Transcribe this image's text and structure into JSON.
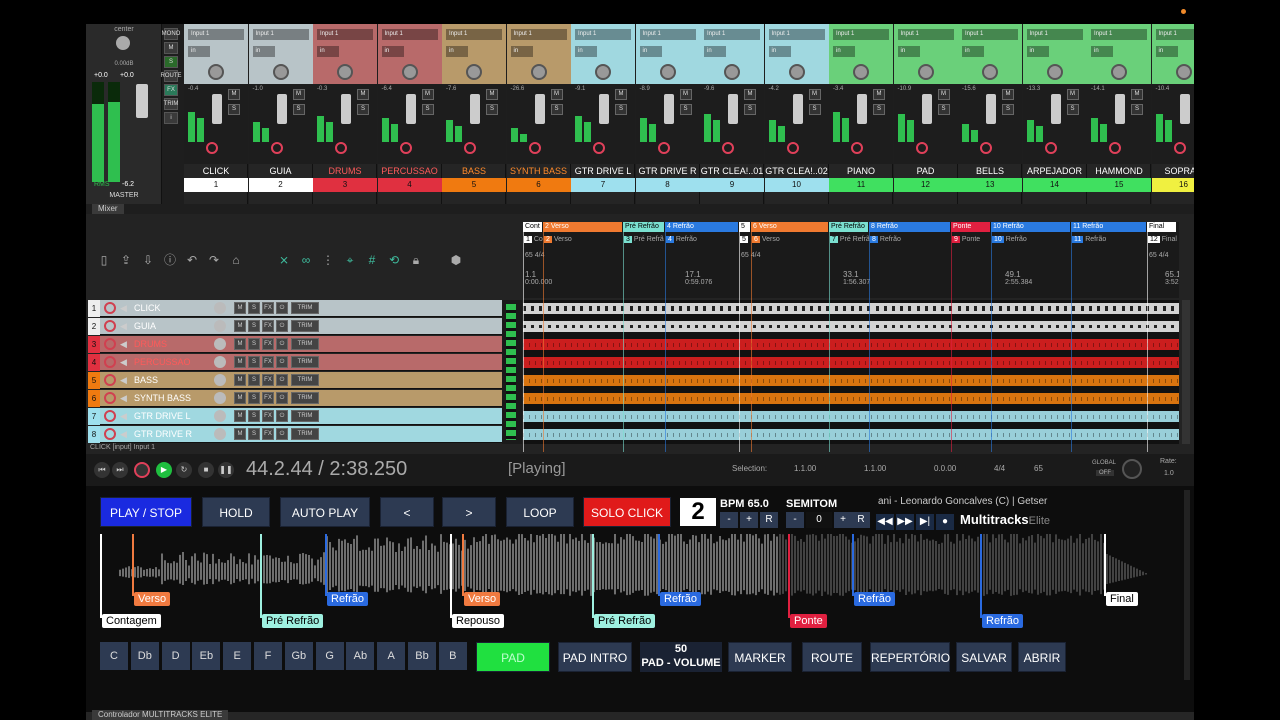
{
  "master": {
    "pan": "center",
    "vol": "0.00dB",
    "peak_l": "+0.0",
    "peak_r": "+0.0",
    "rms_label": "RMS",
    "rms_val": "-6.2",
    "name": "MASTER",
    "side": [
      "MONO",
      "M",
      "S",
      "ROUTE",
      "FX",
      "TRIM"
    ]
  },
  "channels": [
    {
      "input": "Input 1",
      "db": "-0.4",
      "name": "CLICK",
      "num": "1",
      "top": "#b8c4c8",
      "mid": "#c8d0d4",
      "namecolor": "#fff",
      "numbg": "#fff"
    },
    {
      "input": "Input 1",
      "db": "-1.0",
      "name": "GUIA",
      "num": "2",
      "top": "#b8c4c8",
      "mid": "#c8d0d4",
      "namecolor": "#fff",
      "numbg": "#fff"
    },
    {
      "input": "Input 1",
      "db": "-0.3",
      "name": "DRUMS",
      "num": "3",
      "top": "#b86a6a",
      "mid": "#c06060",
      "namecolor": "#ff5a5a",
      "numbg": "#e03040"
    },
    {
      "input": "Input 1",
      "db": "-6.4",
      "name": "PERCUSSAO",
      "num": "4",
      "top": "#b86a6a",
      "mid": "#c06060",
      "namecolor": "#ff5a5a",
      "numbg": "#e03040"
    },
    {
      "input": "Input 1",
      "db": "-7.6",
      "name": "BASS",
      "num": "5",
      "top": "#b89a6a",
      "mid": "#c09060",
      "namecolor": "#ff8a2a",
      "numbg": "#f07a10"
    },
    {
      "input": "Input 1",
      "db": "-26.6",
      "name": "SYNTH BASS",
      "num": "6",
      "top": "#b89a6a",
      "mid": "#c09060",
      "namecolor": "#ff8a2a",
      "numbg": "#f07a10"
    },
    {
      "input": "Input 1",
      "db": "-9.1",
      "name": "GTR DRIVE L",
      "num": "7",
      "top": "#a0d8e0",
      "mid": "#aee0e8",
      "namecolor": "#fff",
      "numbg": "#9ee0ee"
    },
    {
      "input": "Input 1",
      "db": "-8.9",
      "name": "GTR DRIVE R",
      "num": "8",
      "top": "#a0d8e0",
      "mid": "#aee0e8",
      "namecolor": "#fff",
      "numbg": "#9ee0ee"
    },
    {
      "input": "Input 1",
      "db": "-9.6",
      "name": "GTR CLEA!..01",
      "num": "9",
      "top": "#a0d8e0",
      "mid": "#aee0e8",
      "namecolor": "#fff",
      "numbg": "#9ee0ee"
    },
    {
      "input": "Input 1",
      "db": "-4.2",
      "name": "GTR CLEA!..02",
      "num": "10",
      "top": "#a0d8e0",
      "mid": "#aee0e8",
      "namecolor": "#fff",
      "numbg": "#9ee0ee"
    },
    {
      "input": "Input 1",
      "db": "-3.4",
      "name": "PIANO",
      "num": "11",
      "top": "#6ad07a",
      "mid": "#7ad88a",
      "namecolor": "#fff",
      "numbg": "#40e060"
    },
    {
      "input": "Input 1",
      "db": "-10.9",
      "name": "PAD",
      "num": "12",
      "top": "#6ad07a",
      "mid": "#7ad88a",
      "namecolor": "#fff",
      "numbg": "#40e060"
    },
    {
      "input": "Input 1",
      "db": "-15.6",
      "name": "BELLS",
      "num": "13",
      "top": "#6ad07a",
      "mid": "#7ad88a",
      "namecolor": "#fff",
      "numbg": "#40e060"
    },
    {
      "input": "Input 1",
      "db": "-13.3",
      "name": "ARPEJADOR",
      "num": "14",
      "top": "#6ad07a",
      "mid": "#7ad88a",
      "namecolor": "#fff",
      "numbg": "#40e060"
    },
    {
      "input": "Input 1",
      "db": "-14.1",
      "name": "HAMMOND",
      "num": "15",
      "top": "#6ad07a",
      "mid": "#7ad88a",
      "namecolor": "#fff",
      "numbg": "#40e060"
    },
    {
      "input": "Input 1",
      "db": "-10.4",
      "name": "SOPRAN",
      "num": "16",
      "top": "#6ad07a",
      "mid": "#7ad88a",
      "namecolor": "#fff",
      "numbg": "#f0f040"
    }
  ],
  "mixer_tab": "Mixer",
  "tracks": [
    {
      "num": "1",
      "name": "CLICK",
      "bg": "#b8c4c8",
      "color": "#fff",
      "numbg": "#eee"
    },
    {
      "num": "2",
      "name": "GUIA",
      "bg": "#b8c4c8",
      "color": "#fff",
      "numbg": "#eee"
    },
    {
      "num": "3",
      "name": "DRUMS",
      "bg": "#b86a6a",
      "color": "#ff5a5a",
      "numbg": "#e03040"
    },
    {
      "num": "4",
      "name": "PERCUSSAO",
      "bg": "#b86a6a",
      "color": "#ff5a5a",
      "numbg": "#e03040"
    },
    {
      "num": "5",
      "name": "BASS",
      "bg": "#b89a6a",
      "color": "#fff",
      "numbg": "#f07a10"
    },
    {
      "num": "6",
      "name": "SYNTH BASS",
      "bg": "#b89a6a",
      "color": "#fff",
      "numbg": "#f07a10"
    },
    {
      "num": "7",
      "name": "GTR DRIVE L",
      "bg": "#a0d8e0",
      "color": "#fff",
      "numbg": "#9ee0ee"
    },
    {
      "num": "8",
      "name": "GTR DRIVE R",
      "bg": "#a0d8e0",
      "color": "#fff",
      "numbg": "#9ee0ee"
    }
  ],
  "track_btns": {
    "m": "M",
    "s": "S",
    "fx": "FX",
    "trim": "TRIM"
  },
  "lane_colors": [
    "#e8e8e8",
    "#e8e8e8",
    "#e02020",
    "#e02020",
    "#f08010",
    "#f08010",
    "#a8e4f0",
    "#a8e4f0"
  ],
  "markers": [
    {
      "label": "Cont",
      "sub": "1",
      "sub2": "Co",
      "color": "#ffffff"
    },
    {
      "label": "2  Verso",
      "sub": "2",
      "sub2": "Verso",
      "color": "#f07a30"
    },
    {
      "label": "Pré Refrão",
      "sub": "3",
      "sub2": "Pré Refrã",
      "color": "#7ae0d0"
    },
    {
      "label": "4  Refrão",
      "sub": "4",
      "sub2": "Refrão",
      "color": "#2a7ae0"
    },
    {
      "label": "5",
      "sub": "5",
      "sub2": "",
      "color": "#ffffff"
    },
    {
      "label": "6  Verso",
      "sub": "6",
      "sub2": "Verso",
      "color": "#f07a30"
    },
    {
      "label": "Pré Refrão",
      "sub": "7",
      "sub2": "Pré Refrã",
      "color": "#7ae0d0"
    },
    {
      "label": "8  Refrão",
      "sub": "8",
      "sub2": "Refrão",
      "color": "#2a7ae0"
    },
    {
      "label": "Ponte",
      "sub": "9",
      "sub2": "Ponte",
      "color": "#e02040"
    },
    {
      "label": "10  Refrão",
      "sub": "10",
      "sub2": "Refrão",
      "color": "#2a7ae0"
    },
    {
      "label": "11  Refrão",
      "sub": "11",
      "sub2": "Refrão",
      "color": "#2a7ae0"
    },
    {
      "label": "Final",
      "sub": "12",
      "sub2": "Final",
      "color": "#ffffff"
    }
  ],
  "tempo_marks": [
    "65 4/4",
    "65 4/4",
    "65 4/4"
  ],
  "ruler": [
    {
      "bar": "1.1",
      "time": "0:00.000"
    },
    {
      "bar": "17.1",
      "time": "0:59.076"
    },
    {
      "bar": "33.1",
      "time": "1:56.307"
    },
    {
      "bar": "49.1",
      "time": "2:55.384"
    },
    {
      "bar": "65.1",
      "time": "3:52.615"
    }
  ],
  "status_line": "CLICK [input] Input 1",
  "transport": {
    "time": "44.2.44 / 2:38.250",
    "state": "[Playing]",
    "selection_label": "Selection:",
    "sel1": "1.1.00",
    "sel2": "1.1.00",
    "sel3": "0.0.00",
    "sig": "4/4",
    "bpm_small": "65",
    "global": "GLOBAL",
    "off": "OFF",
    "rate_label": "Rate:",
    "rate": "1.0"
  },
  "controller": {
    "play_stop": "PLAY / STOP",
    "hold": "HOLD",
    "auto_play": "AUTO PLAY",
    "prev": "<",
    "next": ">",
    "loop": "LOOP",
    "solo_click": "SOLO CLICK",
    "bpm_num": "2",
    "bpm_label": "BPM 65.0",
    "semitom": "SEMITOM",
    "semitom_val": "0",
    "minus": "-",
    "plus": "+",
    "r": "R",
    "song": "ani - Leonardo Goncalves (C)  |  Getser",
    "logo": "Multitracks",
    "logo2": "Elite",
    "sections": [
      {
        "label": "Contagem",
        "row": 2,
        "bg": "#ffffff",
        "fg": "#000",
        "line": "#ffffff"
      },
      {
        "label": "Verso",
        "row": 1,
        "bg": "#f07a40",
        "fg": "#fff",
        "line": "#f07a40"
      },
      {
        "label": "Pré Refrão",
        "row": 2,
        "bg": "#9ef0e0",
        "fg": "#000",
        "line": "#9ef0e0"
      },
      {
        "label": "Refrão",
        "row": 1,
        "bg": "#2a6ae0",
        "fg": "#fff",
        "line": "#2a6ae0"
      },
      {
        "label": "Repouso",
        "row": 2,
        "bg": "#ffffff",
        "fg": "#000",
        "line": "#ffffff"
      },
      {
        "label": "Verso",
        "row": 1,
        "bg": "#f07a40",
        "fg": "#fff",
        "line": "#f07a40"
      },
      {
        "label": "Pré Refrão",
        "row": 2,
        "bg": "#9ef0e0",
        "fg": "#000",
        "line": "#9ef0e0"
      },
      {
        "label": "Refrão",
        "row": 1,
        "bg": "#2a6ae0",
        "fg": "#fff",
        "line": "#2a6ae0"
      },
      {
        "label": "Ponte",
        "row": 2,
        "bg": "#e02040",
        "fg": "#fff",
        "line": "#e02040"
      },
      {
        "label": "Refrão",
        "row": 1,
        "bg": "#2a6ae0",
        "fg": "#fff",
        "line": "#2a6ae0"
      },
      {
        "label": "Refrão",
        "row": 2,
        "bg": "#2a6ae0",
        "fg": "#fff",
        "line": "#2a6ae0"
      },
      {
        "label": "Final",
        "row": 1,
        "bg": "#ffffff",
        "fg": "#000",
        "line": "#ffffff"
      }
    ],
    "keys": [
      "C",
      "Db",
      "D",
      "Eb",
      "E",
      "F",
      "Gb",
      "G",
      "Ab",
      "A",
      "Bb",
      "B"
    ],
    "pad": "PAD",
    "pad_intro": "PAD INTRO",
    "pad_volume_val": "50",
    "pad_volume": "PAD - VOLUME",
    "marker": "MARKER",
    "route": "ROUTE",
    "repertorio": "REPERTÓRIO",
    "salvar": "SALVAR",
    "abrir": "ABRIR"
  },
  "ctrl_tab": "Controlador MULTITRACKS ELITE",
  "colors": {
    "play": "#1a2ae0",
    "solo": "#e01a1a",
    "pad": "#20e040"
  }
}
